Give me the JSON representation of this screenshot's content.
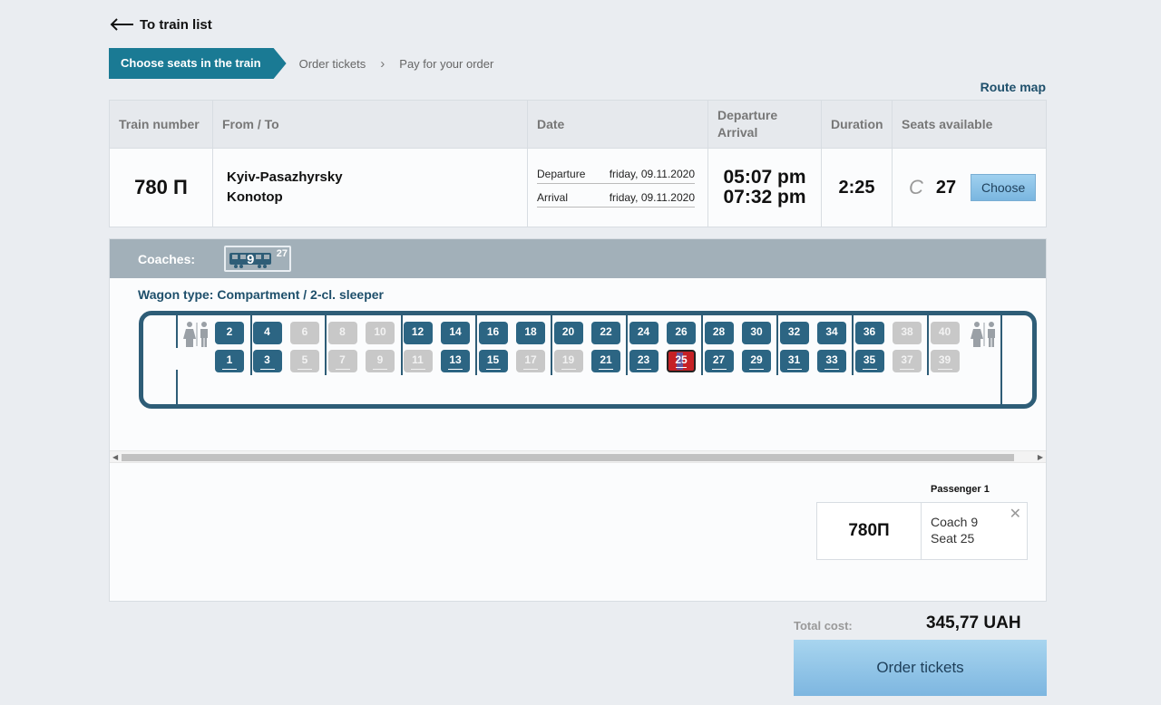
{
  "nav": {
    "back_label": "To train list"
  },
  "steps": [
    {
      "label": "Choose seats in the train",
      "active": true
    },
    {
      "label": "Order tickets",
      "active": false
    },
    {
      "label": "Pay for your order",
      "active": false
    }
  ],
  "route_map_label": "Route map",
  "table": {
    "headers": {
      "train_number": "Train number",
      "from_to": "From / To",
      "date": "Date",
      "departure": "Departure",
      "arrival": "Arrival",
      "duration": "Duration",
      "seats": "Seats available"
    },
    "row": {
      "train_number": "780 П",
      "from": "Kyiv-Pasazhyrsky",
      "to": "Konotop",
      "departure_label": "Departure",
      "departure_date": "friday, 09.11.2020",
      "arrival_label": "Arrival",
      "arrival_date": "friday, 09.11.2020",
      "departure_time": "05:07 pm",
      "arrival_time": "07:32 pm",
      "duration": "2:25",
      "seat_class": "С",
      "seat_count": "27",
      "choose_label": "Choose"
    }
  },
  "coaches": {
    "label": "Coaches:",
    "items": [
      {
        "number": "9",
        "seats": "27"
      }
    ]
  },
  "wagon": {
    "type_label": "Wagon type: Compartment / 2-cl. sleeper",
    "seats": [
      {
        "n": "1",
        "s": "free"
      },
      {
        "n": "2",
        "s": "free"
      },
      {
        "n": "3",
        "s": "free"
      },
      {
        "n": "4",
        "s": "free"
      },
      {
        "n": "5",
        "s": "taken"
      },
      {
        "n": "6",
        "s": "taken"
      },
      {
        "n": "7",
        "s": "taken"
      },
      {
        "n": "8",
        "s": "taken"
      },
      {
        "n": "9",
        "s": "taken"
      },
      {
        "n": "10",
        "s": "taken"
      },
      {
        "n": "11",
        "s": "taken"
      },
      {
        "n": "12",
        "s": "free"
      },
      {
        "n": "13",
        "s": "free"
      },
      {
        "n": "14",
        "s": "free"
      },
      {
        "n": "15",
        "s": "free"
      },
      {
        "n": "16",
        "s": "free"
      },
      {
        "n": "17",
        "s": "taken"
      },
      {
        "n": "18",
        "s": "free"
      },
      {
        "n": "19",
        "s": "taken"
      },
      {
        "n": "20",
        "s": "free"
      },
      {
        "n": "21",
        "s": "free"
      },
      {
        "n": "22",
        "s": "free"
      },
      {
        "n": "23",
        "s": "free"
      },
      {
        "n": "24",
        "s": "free"
      },
      {
        "n": "25",
        "s": "selected"
      },
      {
        "n": "26",
        "s": "free"
      },
      {
        "n": "27",
        "s": "free"
      },
      {
        "n": "28",
        "s": "free"
      },
      {
        "n": "29",
        "s": "free"
      },
      {
        "n": "30",
        "s": "free"
      },
      {
        "n": "31",
        "s": "free"
      },
      {
        "n": "32",
        "s": "free"
      },
      {
        "n": "33",
        "s": "free"
      },
      {
        "n": "34",
        "s": "free"
      },
      {
        "n": "35",
        "s": "free"
      },
      {
        "n": "36",
        "s": "free"
      },
      {
        "n": "37",
        "s": "taken"
      },
      {
        "n": "38",
        "s": "taken"
      },
      {
        "n": "39",
        "s": "taken"
      },
      {
        "n": "40",
        "s": "taken"
      }
    ]
  },
  "passenger": {
    "title": "Passenger 1",
    "train": "780П",
    "coach": "Coach 9",
    "seat": "Seat 25"
  },
  "total": {
    "label": "Total cost:",
    "value": "345,77 UAH"
  },
  "order_label": "Order tickets",
  "colors": {
    "accent": "#1a7a94",
    "seat_free": "#2c6583",
    "seat_taken": "#c8c8c8",
    "seat_selected": "#c62125",
    "button": "#7db6e0"
  }
}
